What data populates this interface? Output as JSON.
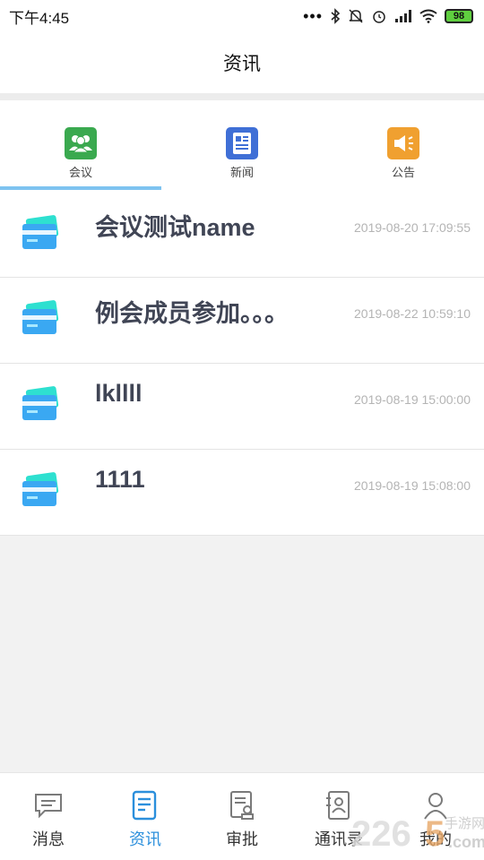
{
  "status": {
    "time": "下午4:45",
    "battery": "98"
  },
  "header": {
    "title": "资讯"
  },
  "tabs": [
    {
      "label": "会议",
      "icon": "meeting-icon",
      "color": "#3aa94f"
    },
    {
      "label": "新闻",
      "icon": "news-icon",
      "color": "#3f6fd6"
    },
    {
      "label": "公告",
      "icon": "announcement-icon",
      "color": "#f0a030"
    }
  ],
  "active_tab": "会议",
  "items": [
    {
      "title": "会议测试name",
      "time": "2019-08-20 17:09:55",
      "icon": "card-icon"
    },
    {
      "title": "例会成员参加。。。",
      "time": "2019-08-22 10:59:10",
      "icon": "card-icon"
    },
    {
      "title": "lkllll",
      "time": "2019-08-19 15:00:00",
      "icon": "card-icon"
    },
    {
      "title": "1111",
      "time": "2019-08-19 15:08:00",
      "icon": "card-icon"
    }
  ],
  "bottom_nav": [
    {
      "label": "消息",
      "icon": "message-icon"
    },
    {
      "label": "资讯",
      "icon": "news-doc-icon",
      "active": true
    },
    {
      "label": "审批",
      "icon": "approval-icon"
    },
    {
      "label": "通讯录",
      "icon": "contacts-icon"
    },
    {
      "label": "我的",
      "icon": "profile-icon"
    }
  ],
  "colors": {
    "accent": "#2b8fdc",
    "tab_underline": "#7ec3f0"
  }
}
